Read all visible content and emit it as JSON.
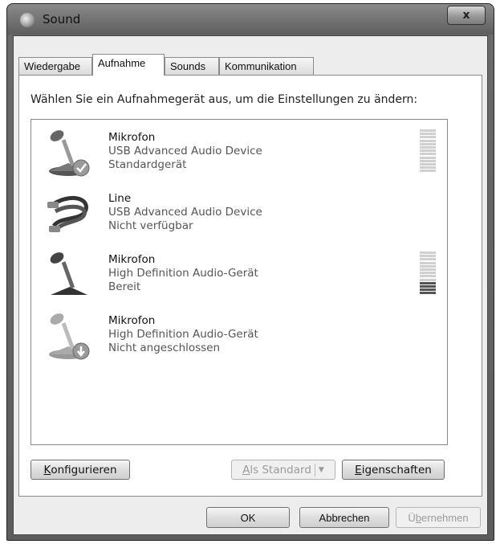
{
  "window": {
    "title": "Sound",
    "close_label": "x"
  },
  "tabs": [
    {
      "label": "Wiedergabe"
    },
    {
      "label": "Aufnahme"
    },
    {
      "label": "Sounds"
    },
    {
      "label": "Kommunikation"
    }
  ],
  "active_tab": "Aufnahme",
  "instruction": "Wählen Sie ein Aufnahmegerät aus, um die Einstellungen zu ändern:",
  "devices": [
    {
      "name": "Mikrofon",
      "driver": "USB Advanced Audio Device",
      "status": "Standardgerät",
      "icon": "microphone-default-check-icon",
      "meter_level": 0.0
    },
    {
      "name": "Line",
      "driver": "USB Advanced Audio Device",
      "status": "Nicht verfügbar",
      "icon": "line-in-cable-icon"
    },
    {
      "name": "Mikrofon",
      "driver": "High Definition Audio-Gerät",
      "status": "Bereit",
      "icon": "microphone-icon",
      "meter_level": 0.3
    },
    {
      "name": "Mikrofon",
      "driver": "High Definition Audio-Gerät",
      "status": "Nicht angeschlossen",
      "icon": "microphone-disconnected-icon"
    }
  ],
  "buttons": {
    "configure": {
      "prefix": "",
      "ul": "K",
      "rest": "onfigurieren"
    },
    "set_default": {
      "prefix": "",
      "ul": "A",
      "rest": "ls Standard"
    },
    "properties": {
      "prefix": "",
      "ul": "E",
      "rest": "igenschaften"
    }
  },
  "footer": {
    "ok": "OK",
    "cancel": "Abbrechen",
    "apply": {
      "prefix": "Ü",
      "ul": "b",
      "rest": "ernehmen"
    }
  }
}
